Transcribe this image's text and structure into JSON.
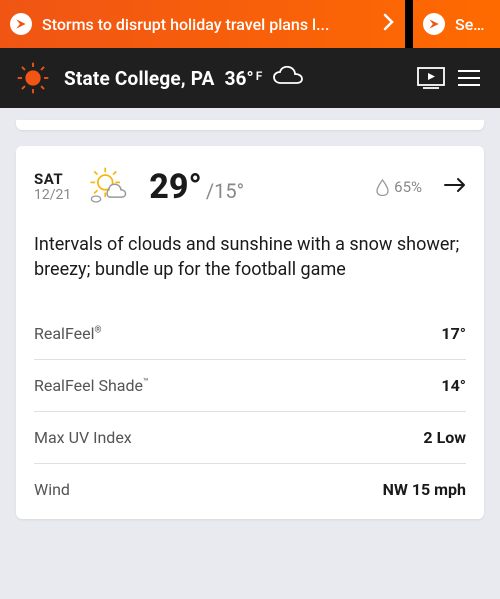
{
  "news": {
    "item1": "Storms to disrupt holiday travel plans l...",
    "item2": "Sever"
  },
  "header": {
    "location": "State College, PA",
    "temp": "36°",
    "unit": "F"
  },
  "forecast": {
    "day": "SAT",
    "date": "12/21",
    "high": "29°",
    "lowPrefix": "/",
    "low": "15°",
    "precip": "65%",
    "description": "Intervals of clouds and sunshine with a snow shower; breezy; bundle up for the football game",
    "details": [
      {
        "label": "RealFeel",
        "sup": "®",
        "value": "17°"
      },
      {
        "label": "RealFeel Shade",
        "sup": "™",
        "value": "14°"
      },
      {
        "label": "Max UV Index",
        "sup": "",
        "value": "2 Low"
      },
      {
        "label": "Wind",
        "sup": "",
        "value": "NW 15 mph"
      }
    ]
  }
}
